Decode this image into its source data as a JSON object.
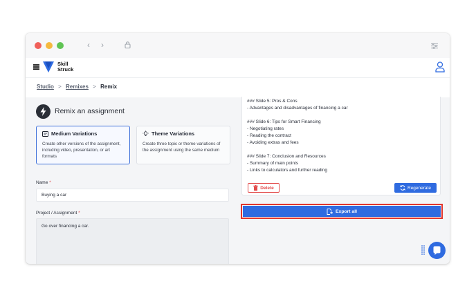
{
  "breadcrumb": {
    "studio": "Studio",
    "remixes": "Remixes",
    "current": "Remix",
    "separator": ">"
  },
  "brand": {
    "line1": "Skill",
    "line2": "Struck"
  },
  "remix": {
    "title": "Remix an assignment",
    "cards": [
      {
        "title": "Medium Variations",
        "description": "Create other versions of the assignment, including video, presentation, or art formats",
        "selected": true,
        "icon": "document-icon"
      },
      {
        "title": "Theme Variations",
        "description": "Create three topic or theme variations of the assignment using the same medium",
        "selected": false,
        "icon": "lightbulb-icon"
      }
    ],
    "name_label": "Name",
    "name_value": "Buying a car",
    "project_label": "Project / Assignment",
    "project_value": "Go over financing a car.",
    "required_mark": "*"
  },
  "outline": [
    "### Slide 5: Pros & Cons",
    "- Advantages and disadvantages of financing a car",
    "",
    "### Slide 6: Tips for Smart Financing",
    "- Negotiating rates",
    "- Reading the contract",
    "- Avoiding extras and fees",
    "",
    "### Slide 7: Conclusion and Resources",
    "- Summary of main points",
    "- Links to calculators and further reading"
  ],
  "actions": {
    "delete": "Delete",
    "regenerate": "Regenerate",
    "export": "Export all"
  },
  "colors": {
    "accent": "#2f6be0",
    "danger": "#e24b4b",
    "highlight": "#e2352c"
  }
}
